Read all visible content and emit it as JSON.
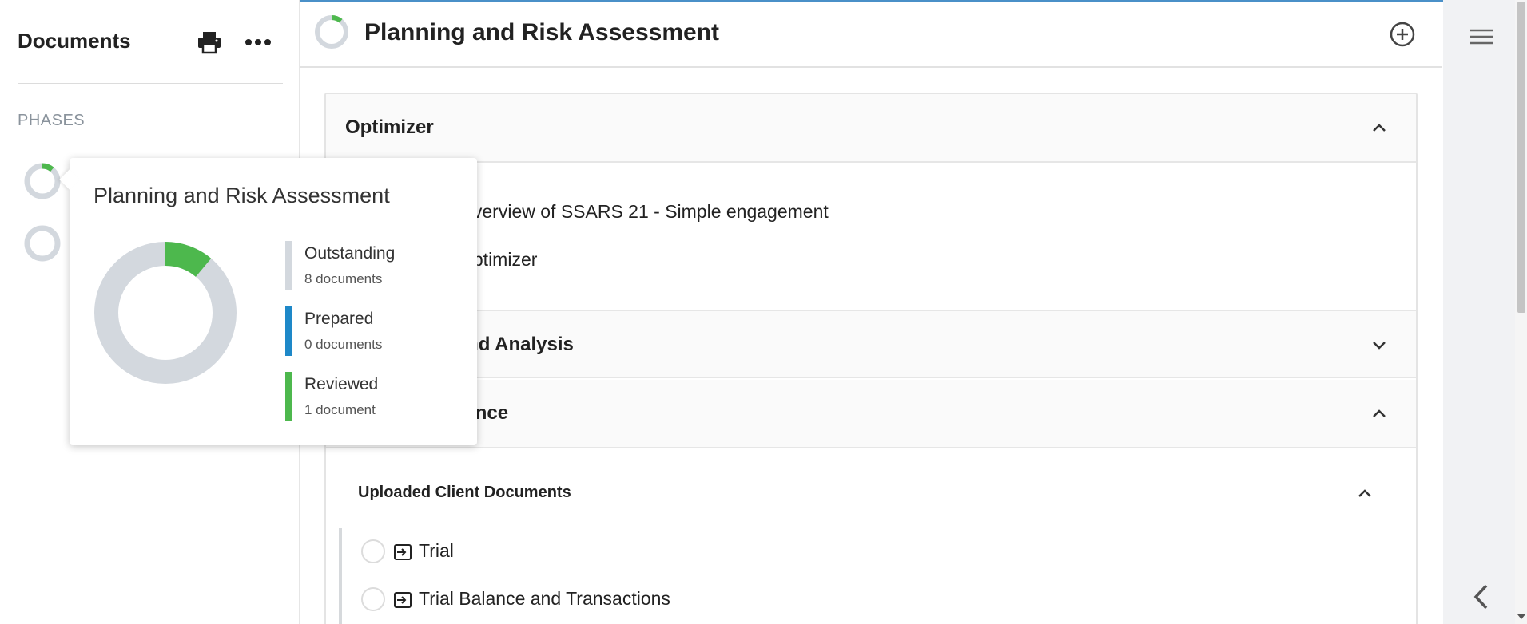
{
  "sidebar": {
    "title": "Documents",
    "phases_heading": "PHASES",
    "icons": {
      "print": "printer-icon",
      "more": "more-horizontal-icon"
    }
  },
  "header": {
    "title": "Planning and Risk Assessment",
    "progress_fraction": 0.111,
    "icons": {
      "add": "add-circle-icon"
    }
  },
  "sections": [
    {
      "label": "Optimizer",
      "expanded": true,
      "items": [
        "Overview of SSARS 21 - Simple engagement",
        "Optimizer"
      ]
    },
    {
      "label": "Procedures and Analysis",
      "expanded": false
    },
    {
      "label": "Client acceptance",
      "expanded": true,
      "subsections": [
        {
          "label": "Uploaded Client Documents",
          "expanded": true,
          "items": [
            {
              "text": "Trial"
            },
            {
              "text": "Trial Balance and Transactions"
            }
          ]
        }
      ]
    }
  ],
  "popover": {
    "title": "Planning and Risk Assessment",
    "stats": [
      {
        "name": "Outstanding",
        "count_text": "8 documents",
        "count": 8,
        "color": "#d3d8de"
      },
      {
        "name": "Prepared",
        "count_text": "0 documents",
        "count": 0,
        "color": "#1e88c8"
      },
      {
        "name": "Reviewed",
        "count_text": "1 document",
        "count": 1,
        "color": "#4db84d"
      }
    ]
  },
  "colors": {
    "accent_green": "#4db84d",
    "accent_blue": "#1e88c8",
    "ring_gray": "#d3d8de"
  },
  "right_rail": {
    "icons": {
      "menu": "hamburger-menu-icon",
      "collapse": "chevron-left-icon"
    }
  }
}
